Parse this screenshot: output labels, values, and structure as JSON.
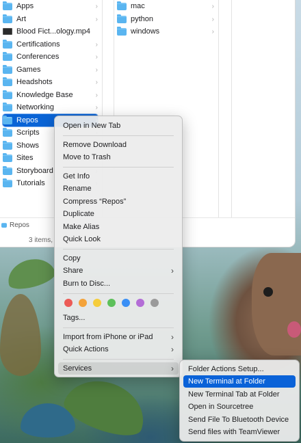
{
  "column1": {
    "items": [
      {
        "label": "Apps",
        "kind": "folder",
        "chevron": true
      },
      {
        "label": "Art",
        "kind": "folder",
        "chevron": true
      },
      {
        "label": "Blood Fict...ology.mp4",
        "kind": "file",
        "chevron": false
      },
      {
        "label": "Certifications",
        "kind": "folder",
        "chevron": true
      },
      {
        "label": "Conferences",
        "kind": "folder",
        "chevron": true
      },
      {
        "label": "Games",
        "kind": "folder",
        "chevron": true
      },
      {
        "label": "Headshots",
        "kind": "folder",
        "chevron": true
      },
      {
        "label": "Knowledge Base",
        "kind": "folder",
        "chevron": true
      },
      {
        "label": "Networking",
        "kind": "folder",
        "chevron": true
      },
      {
        "label": "Repos",
        "kind": "folder",
        "chevron": true,
        "selected": true
      },
      {
        "label": "Scripts",
        "kind": "folder",
        "chevron": true
      },
      {
        "label": "Shows",
        "kind": "folder",
        "chevron": true
      },
      {
        "label": "Sites",
        "kind": "folder",
        "chevron": true
      },
      {
        "label": "Storyboard",
        "kind": "folder",
        "chevron": true
      },
      {
        "label": "Tutorials",
        "kind": "folder",
        "chevron": true
      }
    ]
  },
  "column2": {
    "items": [
      {
        "label": "mac",
        "kind": "folder",
        "chevron": true
      },
      {
        "label": "python",
        "kind": "folder",
        "chevron": true
      },
      {
        "label": "windows",
        "kind": "folder",
        "chevron": true
      }
    ]
  },
  "chevron_glyph": "›",
  "submenu_glyph": "›",
  "pathbar": {
    "label": "Repos"
  },
  "statusbar": {
    "text": "3 items,"
  },
  "context_menu": {
    "groups": [
      [
        "Open in New Tab"
      ],
      [
        "Remove Download",
        "Move to Trash"
      ],
      [
        "Get Info",
        "Rename",
        "Compress “Repos”",
        "Duplicate",
        "Make Alias",
        "Quick Look"
      ],
      [
        "Copy",
        "Share",
        "Burn to Disc..."
      ],
      [
        "Tags..."
      ],
      [
        "Import from iPhone or iPad",
        "Quick Actions"
      ],
      [
        "Services"
      ]
    ],
    "items": {
      "open_new_tab": "Open in New Tab",
      "remove_download": "Remove Download",
      "move_to_trash": "Move to Trash",
      "get_info": "Get Info",
      "rename": "Rename",
      "compress": "Compress “Repos”",
      "duplicate": "Duplicate",
      "make_alias": "Make Alias",
      "quick_look": "Quick Look",
      "copy": "Copy",
      "share": "Share",
      "burn": "Burn to Disc...",
      "tags": "Tags...",
      "import_iphone": "Import from iPhone or iPad",
      "quick_actions": "Quick Actions",
      "services": "Services"
    },
    "tag_colors": [
      "#ec5b56",
      "#f4a33a",
      "#f5cd3c",
      "#5dc05a",
      "#3a8ff5",
      "#b36dd6",
      "#9a9a9a"
    ]
  },
  "services_menu": {
    "items": {
      "folder_actions_setup": "Folder Actions Setup...",
      "new_terminal_at_folder": "New Terminal at Folder",
      "new_terminal_tab_at_folder": "New Terminal Tab at Folder",
      "open_in_sourcetree": "Open in Sourcetree",
      "send_file_bluetooth": "Send File To Bluetooth Device",
      "send_files_teamviewer": "Send files with TeamViewer"
    },
    "highlighted": "New Terminal at Folder"
  },
  "colors": {
    "selection": "#0a64d6",
    "menu_highlight": "#0a62d8",
    "folder": "#5ab5f0"
  }
}
